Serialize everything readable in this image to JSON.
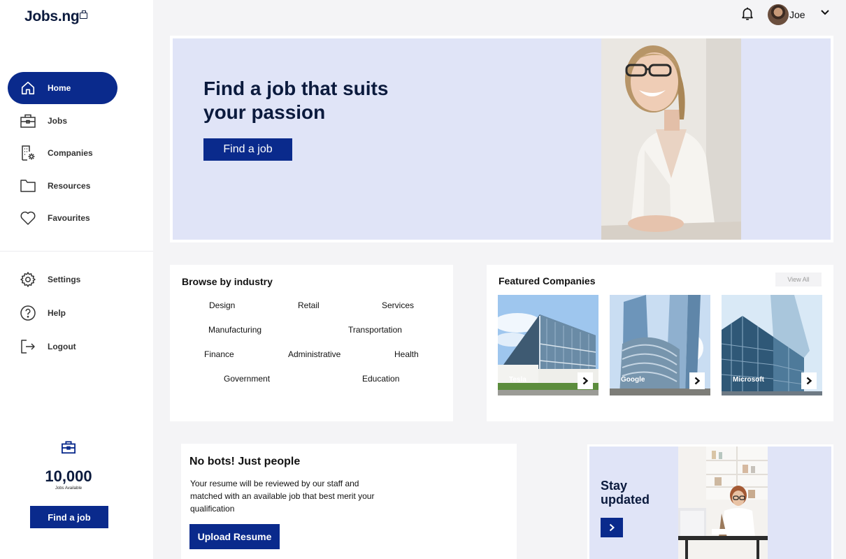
{
  "app": {
    "logo": "Jobs.ng"
  },
  "sidebar": {
    "items": [
      {
        "label": "Home",
        "icon": "home-icon",
        "active": true
      },
      {
        "label": "Jobs",
        "icon": "briefcase-icon"
      },
      {
        "label": "Companies",
        "icon": "building-icon"
      },
      {
        "label": "Resources",
        "icon": "folder-icon"
      },
      {
        "label": "Favourites",
        "icon": "heart-icon"
      }
    ],
    "secondary": [
      {
        "label": "Settings",
        "icon": "gear-icon"
      },
      {
        "label": "Help",
        "icon": "help-icon"
      },
      {
        "label": "Logout",
        "icon": "logout-icon"
      }
    ],
    "stat": {
      "count": "10,000",
      "label": "Jobs Available"
    },
    "cta": "Find a job"
  },
  "topbar": {
    "user_name": "Joe"
  },
  "hero": {
    "title": "Find a job that suits your passion",
    "button": "Find a job"
  },
  "browse": {
    "title": "Browse by industry",
    "industries": [
      "Design",
      "Retail",
      "Services",
      "Manufacturing",
      "Transportation",
      "Finance",
      "Administrative",
      "Health",
      "Government",
      "Education"
    ]
  },
  "featured": {
    "title": "Featured Companies",
    "view_all": "View All",
    "companies": [
      {
        "name": "Tesla"
      },
      {
        "name": "Google"
      },
      {
        "name": "Microsoft"
      }
    ]
  },
  "nobots": {
    "title": "No bots! Just people",
    "text": "Your resume will be reviewed by our staff and matched with an available job that best merit your qualification",
    "button": "Upload Resume"
  },
  "stay": {
    "title": "Stay updated"
  },
  "colors": {
    "primary": "#0a2a8c",
    "hero_bg": "#e0e4f7",
    "text_dark": "#0b1a3d"
  }
}
